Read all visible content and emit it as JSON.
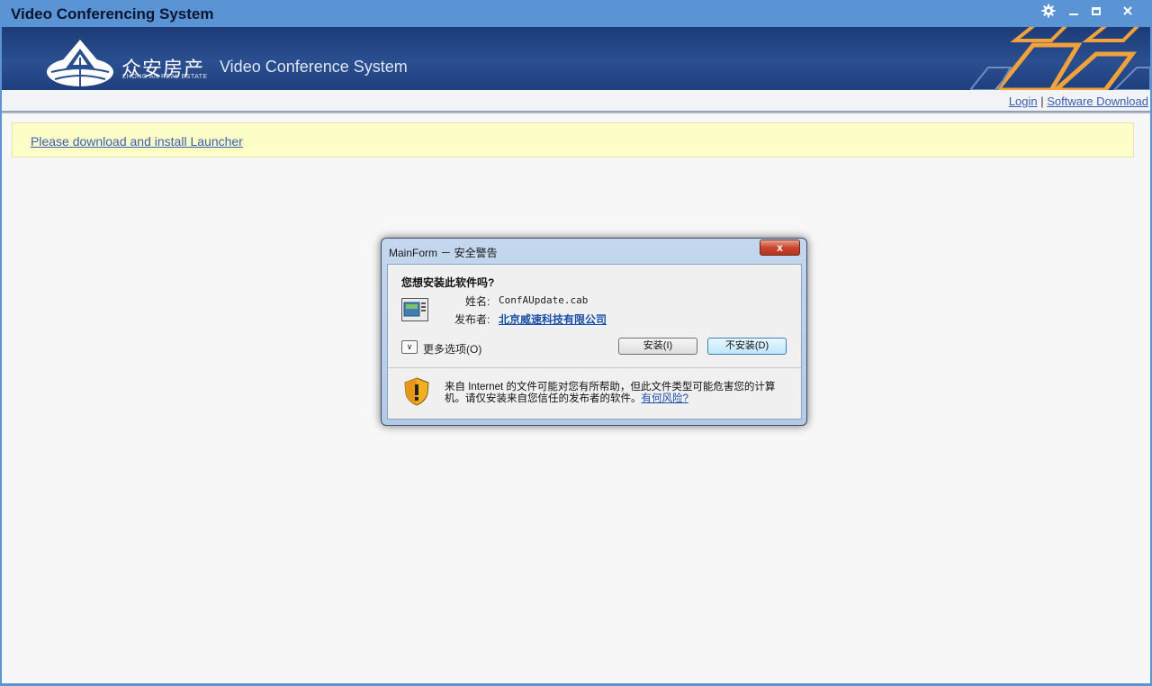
{
  "window": {
    "title": "Video Conferencing System"
  },
  "banner": {
    "brand_cn": "众安房产",
    "brand_en": "ZHONG AN REAL ESTATE",
    "title": "Video Conference System"
  },
  "linkbar": {
    "login": "Login",
    "separator": "|",
    "software_download": "Software Download"
  },
  "notice": {
    "link": "Please download and install Launcher"
  },
  "dialog": {
    "title": "MainForm － 安全警告",
    "close": "x",
    "question": "您想安装此软件吗?",
    "name_label": "姓名:",
    "name_value": "ConfAUpdate.cab",
    "publisher_label": "发布者:",
    "publisher_value": "北京威速科技有限公司",
    "more_options": "更多选项(O)",
    "install_button": "安装(I)",
    "no_install_button": "不安装(D)",
    "warning_text": "来自 Internet 的文件可能对您有所帮助，但此文件类型可能危害您的计算机。请仅安装来自您信任的发布者的软件。",
    "risk_link": "有何风险?"
  },
  "colors": {
    "titlebar": "#5b94d4",
    "banner": "#1d3b78",
    "notice_bg": "#fdfdc8",
    "link": "#3a5fb0"
  }
}
